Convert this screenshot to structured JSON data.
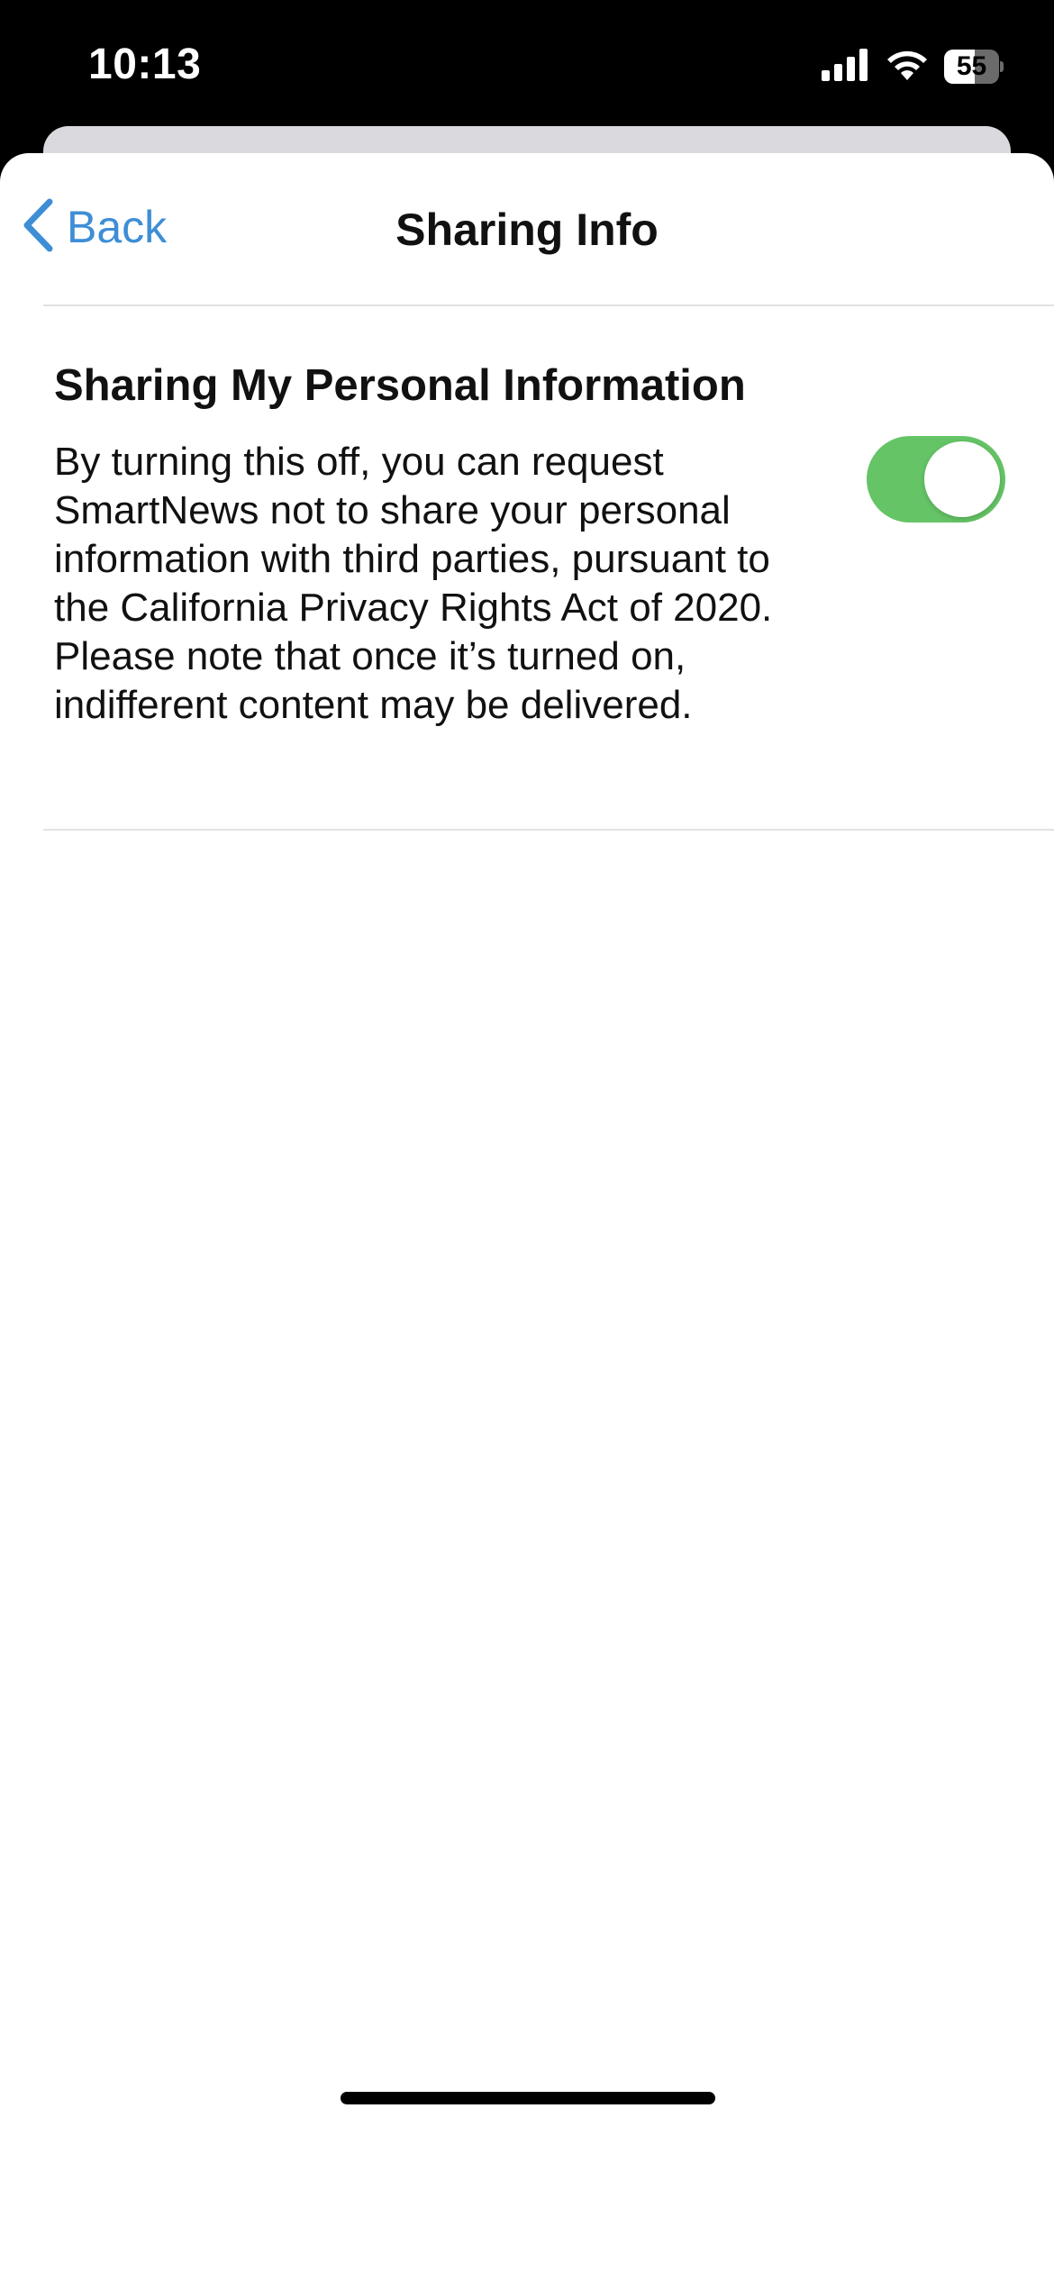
{
  "status_bar": {
    "time": "10:13",
    "battery_level": "55",
    "battery_fraction": 0.55,
    "icons": [
      "cellular-signal-icon",
      "wifi-icon",
      "battery-icon"
    ]
  },
  "nav": {
    "back_label": "Back",
    "title": "Sharing Info"
  },
  "setting": {
    "title": "Sharing My Personal Information",
    "description": "By turning this off, you can request SmartNews not to share your personal information with third parties, pursuant to the California Privacy Rights Act of 2020. Please note that once it’s turned on, indifferent content may be delivered.",
    "toggle_on": true
  },
  "colors": {
    "accent": "#3e8ed6",
    "toggle_on": "#65c466",
    "text": "#111111",
    "divider": "#e2e2e6"
  }
}
